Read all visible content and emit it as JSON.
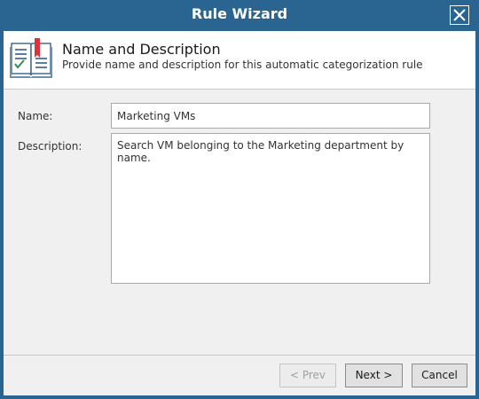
{
  "window": {
    "title": "Rule Wizard"
  },
  "header": {
    "title": "Name and Description",
    "subtitle": "Provide name and description for this automatic categorization rule",
    "icon": "book-icon"
  },
  "form": {
    "name_label": "Name:",
    "name_value": "Marketing VMs",
    "description_label": "Description:",
    "description_value": "Search VM belonging to the Marketing department by name."
  },
  "buttons": {
    "prev": "< Prev",
    "next": "Next >",
    "cancel": "Cancel"
  },
  "colors": {
    "titlebar": "#2a6592",
    "client": "#f0f0f0",
    "bookmark": "#e0323c"
  }
}
